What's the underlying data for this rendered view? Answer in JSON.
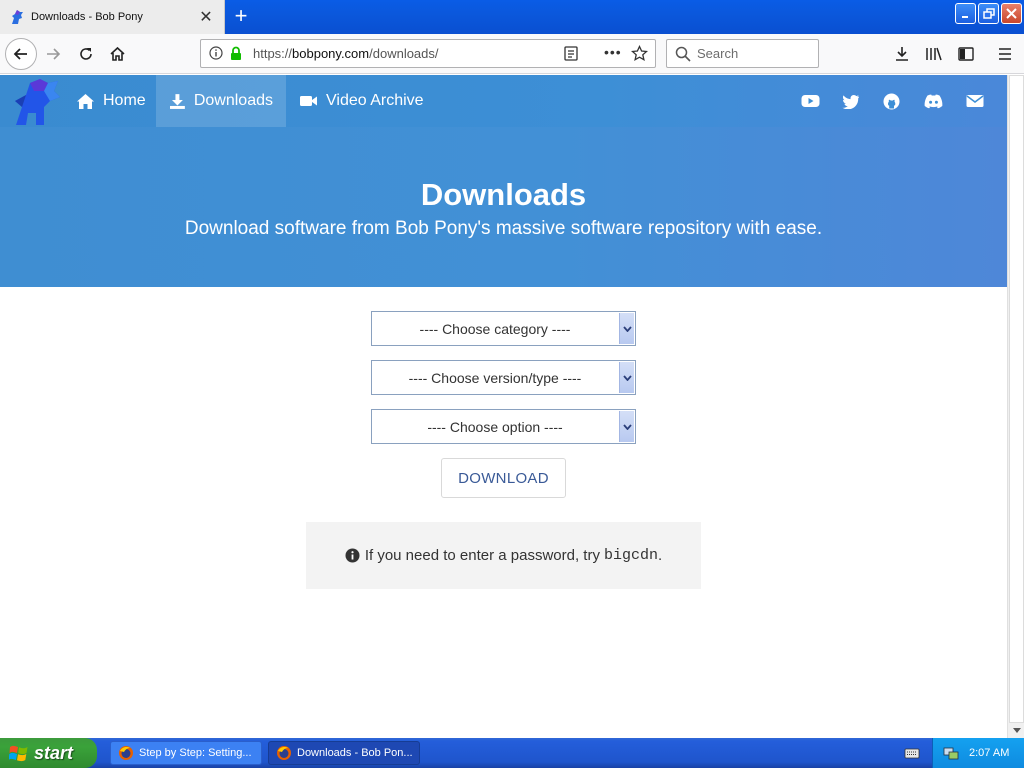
{
  "browser": {
    "tab_title": "Downloads - Bob Pony",
    "new_tab_symbol": "+",
    "url_scheme": "https://",
    "url_host": "bobpony.com",
    "url_path": "/downloads/",
    "search_placeholder": "Search",
    "page_actions_symbol": "•••"
  },
  "site": {
    "nav": [
      {
        "label": "Home",
        "icon": "home-icon"
      },
      {
        "label": "Downloads",
        "icon": "download-icon"
      },
      {
        "label": "Video Archive",
        "icon": "video-camera-icon"
      }
    ],
    "social_icons": [
      "youtube-icon",
      "twitter-icon",
      "github-icon",
      "discord-icon",
      "mail-icon"
    ],
    "hero_title": "Downloads",
    "hero_subtitle": "Download software from Bob Pony's massive software repository with ease.",
    "selects": [
      "---- Choose category ----",
      "---- Choose version/type ----",
      "---- Choose option ----"
    ],
    "download_button": "DOWNLOAD",
    "notice_text": "If you need to enter a password, try",
    "notice_password": "bigcdn",
    "notice_end": "."
  },
  "taskbar": {
    "start_label": "start",
    "tasks": [
      {
        "label": "Step by Step: Setting...",
        "active": false
      },
      {
        "label": "Downloads - Bob Pon...",
        "active": true
      }
    ],
    "clock": "2:07 AM"
  },
  "colors": {
    "hero_blue": "#3f8ed2",
    "download_text": "#3a5a97",
    "taskbar_blue": "#245edb",
    "start_green": "#3aa23a"
  }
}
